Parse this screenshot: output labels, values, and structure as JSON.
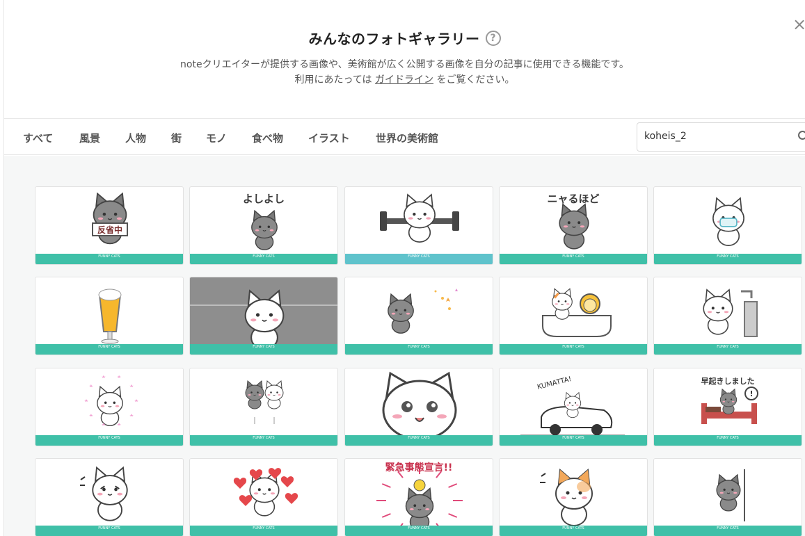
{
  "header": {
    "title": "みんなのフォトギャラリー",
    "help_icon": "?",
    "desc_line1": "noteクリエイターが提供する画像や、美術館が広く公開する画像を自分の記事に使用できる機能です。",
    "desc_line2_prefix": "利用にあたっては",
    "desc_link": "ガイドライン",
    "desc_line2_suffix": "をご覧ください。",
    "close_icon": "×"
  },
  "tabs": [
    "すべて",
    "風景",
    "人物",
    "街",
    "モノ",
    "食べ物",
    "イラスト",
    "世界の美術館"
  ],
  "search": {
    "value": "koheis_2",
    "icon": "search-icon"
  },
  "gallery": {
    "badge": "FUNNY CATS",
    "captions": [
      "",
      "よしよし",
      "",
      "ニャるほど",
      "",
      "",
      "",
      "",
      "",
      "",
      "",
      "",
      "",
      "",
      "早起きしました",
      "",
      "",
      "緊急事態宣言!!",
      "",
      ""
    ],
    "sign_text": "反省中",
    "kumatta_text": "KUMATTA!",
    "accent_color": "#3fc0a8"
  }
}
